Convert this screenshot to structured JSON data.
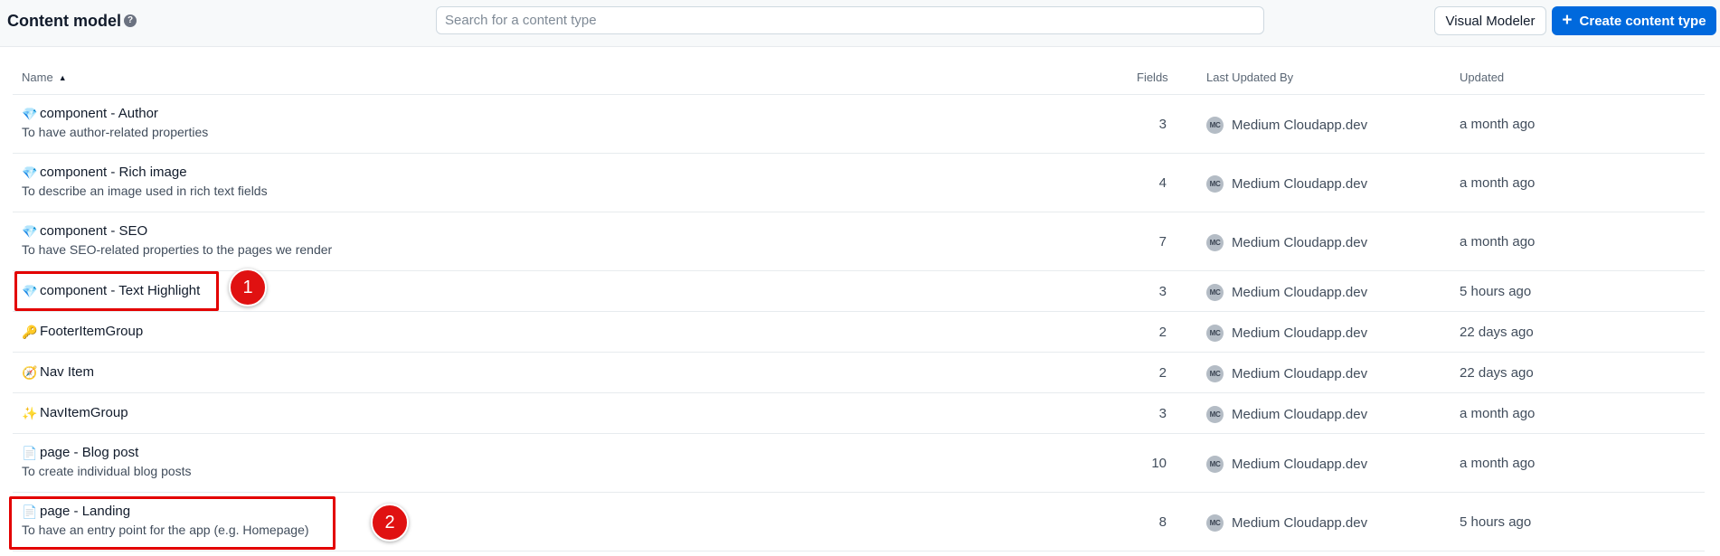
{
  "header": {
    "title": "Content model",
    "help_icon": "?",
    "search_placeholder": "Search for a content type",
    "visual_modeler_label": "Visual Modeler",
    "create_label": "Create content type",
    "create_icon": "+"
  },
  "table": {
    "columns": {
      "name": "Name",
      "fields": "Fields",
      "last_updated_by": "Last Updated By",
      "updated": "Updated"
    },
    "rows": [
      {
        "emoji": "💎",
        "name": "component - Author",
        "description": "To have author-related properties",
        "fields": "3",
        "avatar": "MC",
        "user": "Medium Cloudapp.dev",
        "updated": "a month ago"
      },
      {
        "emoji": "💎",
        "name": "component - Rich image",
        "description": "To describe an image used in rich text fields",
        "fields": "4",
        "avatar": "MC",
        "user": "Medium Cloudapp.dev",
        "updated": "a month ago"
      },
      {
        "emoji": "💎",
        "name": "component - SEO",
        "description": "To have SEO-related properties to the pages we render",
        "fields": "7",
        "avatar": "MC",
        "user": "Medium Cloudapp.dev",
        "updated": "a month ago"
      },
      {
        "emoji": "💎",
        "name": "component - Text Highlight",
        "description": "",
        "fields": "3",
        "avatar": "MC",
        "user": "Medium Cloudapp.dev",
        "updated": "5 hours ago"
      },
      {
        "emoji": "🔑",
        "name": "FooterItemGroup",
        "description": "",
        "fields": "2",
        "avatar": "MC",
        "user": "Medium Cloudapp.dev",
        "updated": "22 days ago"
      },
      {
        "emoji": "🧭",
        "name": "Nav Item",
        "description": "",
        "fields": "2",
        "avatar": "MC",
        "user": "Medium Cloudapp.dev",
        "updated": "22 days ago"
      },
      {
        "emoji": "✨",
        "name": "NavItemGroup",
        "description": "",
        "fields": "3",
        "avatar": "MC",
        "user": "Medium Cloudapp.dev",
        "updated": "a month ago"
      },
      {
        "emoji": "📄",
        "name": "page - Blog post",
        "description": "To create individual blog posts",
        "fields": "10",
        "avatar": "MC",
        "user": "Medium Cloudapp.dev",
        "updated": "a month ago"
      },
      {
        "emoji": "📄",
        "name": "page - Landing",
        "description": "To have an entry point for the app (e.g. Homepage)",
        "fields": "8",
        "avatar": "MC",
        "user": "Medium Cloudapp.dev",
        "updated": "5 hours ago"
      }
    ]
  },
  "annotations": [
    {
      "label": "1"
    },
    {
      "label": "2"
    }
  ],
  "colors": {
    "primary": "#0069dd",
    "annotation": "#e30000"
  }
}
